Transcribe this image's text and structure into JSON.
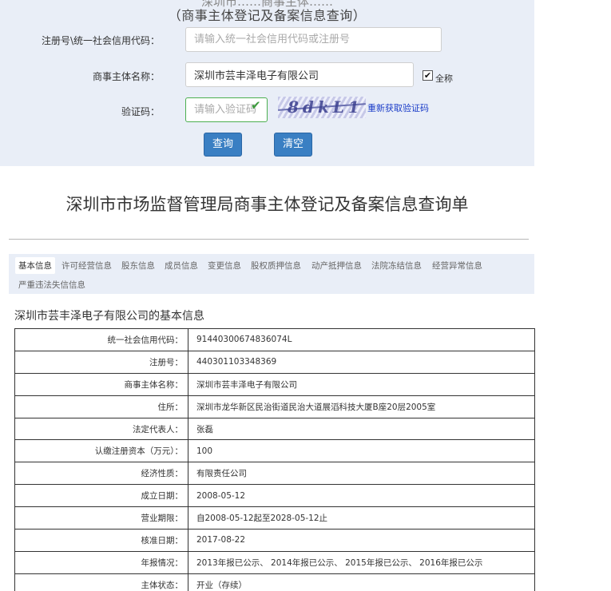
{
  "header": {
    "title_partial": "深圳市……商事主体……",
    "subtitle": "（商事主体登记及备案信息查询）"
  },
  "form": {
    "reg_label": "注册号\\统一社会信用代码：",
    "reg_placeholder": "请输入统一社会信用代码或注册号",
    "name_label": "商事主体名称：",
    "name_value": "深圳市芸丰泽电子有限公司",
    "fullname_label": "全称",
    "fullname_checked": true,
    "captcha_label": "验证码：",
    "captcha_placeholder": "请输入验证码",
    "captcha_text": "8dkL1 T",
    "refresh_label": "重新获取验证码",
    "query_button": "查询",
    "clear_button": "清空"
  },
  "report": {
    "title": "深圳市市场监督管理局商事主体登记及备案信息查询单",
    "tabs": [
      "基本信息",
      "许可经营信息",
      "股东信息",
      "成员信息",
      "变更信息",
      "股权质押信息",
      "动产抵押信息",
      "法院冻结信息",
      "经营异常信息",
      "严重违法失信信息"
    ],
    "active_tab": "基本信息",
    "section_title": "深圳市芸丰泽电子有限公司的基本信息",
    "rows": [
      {
        "label": "统一社会信用代码：",
        "value": "91440300674836074L"
      },
      {
        "label": "注册号：",
        "value": "440301103348369"
      },
      {
        "label": "商事主体名称：",
        "value": "深圳市芸丰泽电子有限公司"
      },
      {
        "label": "住所：",
        "value": "深圳市龙华新区民治街道民治大道展滔科技大厦B座20层2005室"
      },
      {
        "label": "法定代表人：",
        "value": "张磊"
      },
      {
        "label": "认缴注册资本（万元）：",
        "value": "100"
      },
      {
        "label": "经济性质：",
        "value": "有限责任公司"
      },
      {
        "label": "成立日期：",
        "value": "2008-05-12"
      },
      {
        "label": "营业期限：",
        "value": "自2008-05-12起至2028-05-12止"
      },
      {
        "label": "核准日期：",
        "value": "2017-08-22"
      },
      {
        "label": "年报情况：",
        "value": "2013年报已公示、 2014年报已公示、 2015年报已公示、 2016年报已公示"
      },
      {
        "label": "主体状态：",
        "value": "开业（存续）"
      }
    ]
  },
  "colors": {
    "panel_bg": "#e9eef7",
    "button_bg": "#3a7fc3",
    "link": "#1a3cc8",
    "valid_border": "#4caf50"
  }
}
